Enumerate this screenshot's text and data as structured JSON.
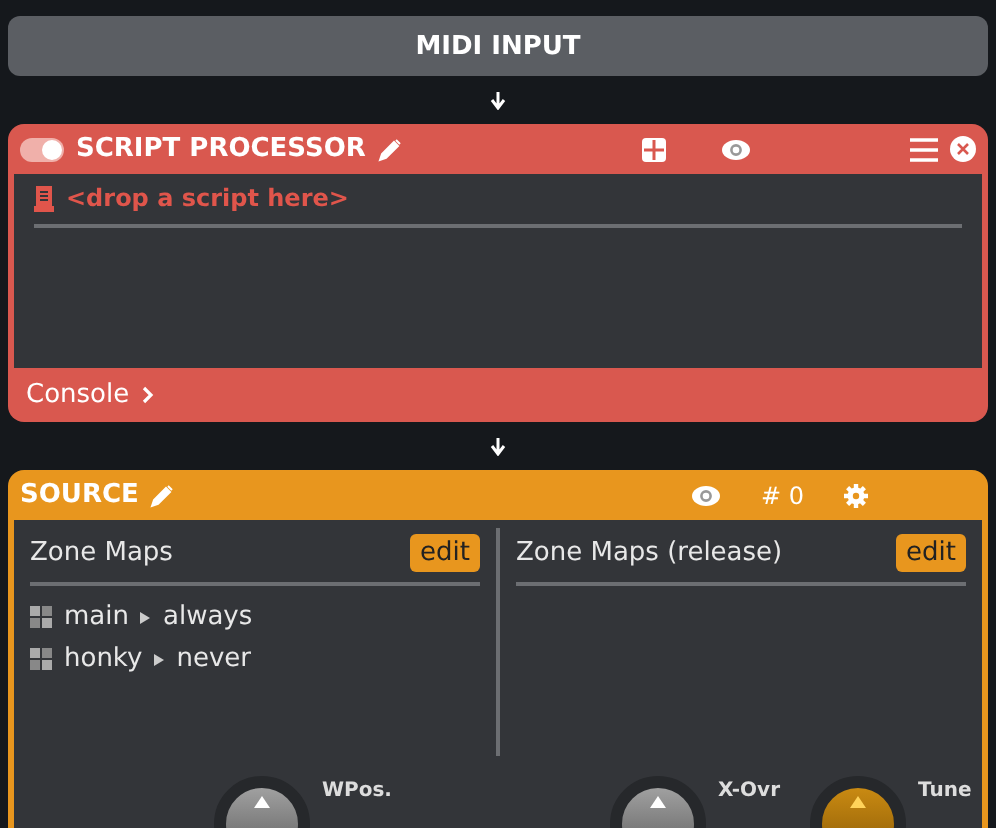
{
  "midi_input": {
    "label": "MIDI INPUT"
  },
  "script_processor": {
    "title": "SCRIPT PROCESSOR",
    "enabled": true,
    "script_placeholder": "<drop a script here>",
    "console_label": "Console"
  },
  "source": {
    "title": "SOURCE",
    "group_count": "# 0",
    "panes": [
      {
        "title": "Zone Maps",
        "edit_label": "edit",
        "items": [
          {
            "name": "main",
            "condition": "always"
          },
          {
            "name": "honky",
            "condition": "never"
          }
        ]
      },
      {
        "title": "Zone Maps (release)",
        "edit_label": "edit"
      }
    ],
    "knobs": [
      {
        "label": "WPos.",
        "highlighted": false
      },
      {
        "label": "X-Ovr",
        "highlighted": false
      },
      {
        "label": "Tune",
        "highlighted": true
      }
    ]
  }
}
